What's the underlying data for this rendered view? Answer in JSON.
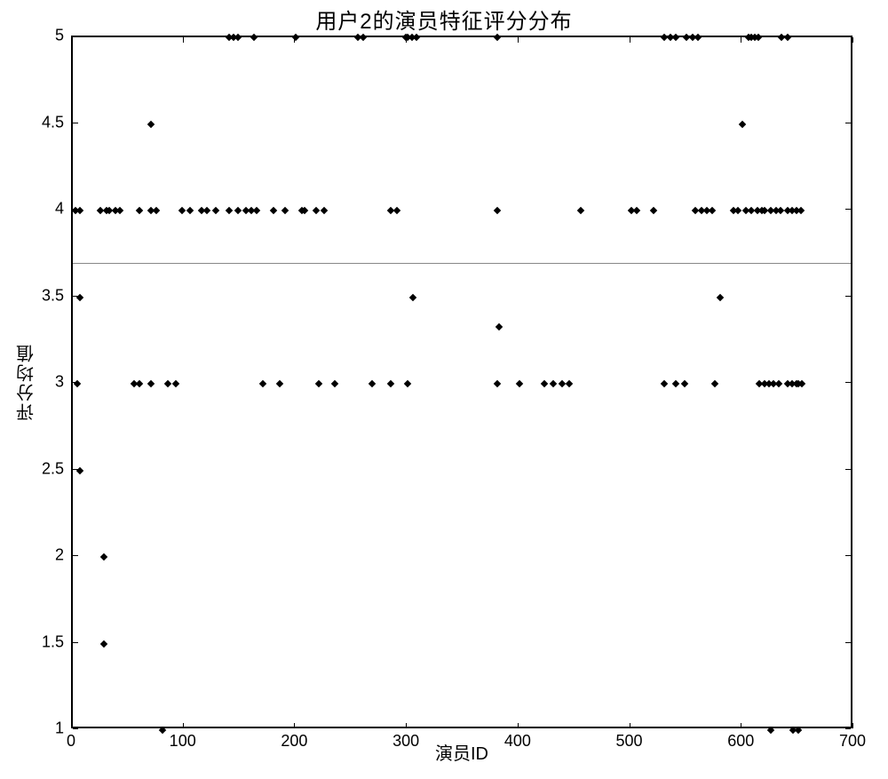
{
  "chart_data": {
    "type": "scatter",
    "title": "用户2的演员特征评分分布",
    "xlabel": "演员ID",
    "ylabel": "评分均值",
    "xlim": [
      0,
      700
    ],
    "ylim": [
      1,
      5
    ],
    "xticks": [
      0,
      100,
      200,
      300,
      400,
      500,
      600,
      700
    ],
    "yticks": [
      1,
      1.5,
      2,
      2.5,
      3,
      3.5,
      4,
      4.5,
      5
    ],
    "reference_line_y": 3.7,
    "points": [
      {
        "x": 2,
        "y": 4
      },
      {
        "x": 6,
        "y": 4
      },
      {
        "x": 4,
        "y": 3
      },
      {
        "x": 6,
        "y": 3.5
      },
      {
        "x": 6,
        "y": 2.5
      },
      {
        "x": 25,
        "y": 4
      },
      {
        "x": 30,
        "y": 4
      },
      {
        "x": 33,
        "y": 4
      },
      {
        "x": 38,
        "y": 4
      },
      {
        "x": 42,
        "y": 4
      },
      {
        "x": 28,
        "y": 2
      },
      {
        "x": 28,
        "y": 1.5
      },
      {
        "x": 55,
        "y": 3
      },
      {
        "x": 60,
        "y": 3
      },
      {
        "x": 60,
        "y": 4
      },
      {
        "x": 70,
        "y": 4
      },
      {
        "x": 70,
        "y": 3
      },
      {
        "x": 75,
        "y": 4
      },
      {
        "x": 85,
        "y": 3
      },
      {
        "x": 92,
        "y": 3
      },
      {
        "x": 98,
        "y": 4
      },
      {
        "x": 105,
        "y": 4
      },
      {
        "x": 70,
        "y": 4.5
      },
      {
        "x": 80,
        "y": 1
      },
      {
        "x": 115,
        "y": 4
      },
      {
        "x": 120,
        "y": 4
      },
      {
        "x": 128,
        "y": 4
      },
      {
        "x": 140,
        "y": 5
      },
      {
        "x": 144,
        "y": 5
      },
      {
        "x": 148,
        "y": 5
      },
      {
        "x": 140,
        "y": 4
      },
      {
        "x": 148,
        "y": 4
      },
      {
        "x": 155,
        "y": 4
      },
      {
        "x": 160,
        "y": 4
      },
      {
        "x": 165,
        "y": 4
      },
      {
        "x": 162,
        "y": 5
      },
      {
        "x": 170,
        "y": 3
      },
      {
        "x": 180,
        "y": 4
      },
      {
        "x": 185,
        "y": 3
      },
      {
        "x": 190,
        "y": 4
      },
      {
        "x": 200,
        "y": 5
      },
      {
        "x": 205,
        "y": 4
      },
      {
        "x": 208,
        "y": 4
      },
      {
        "x": 218,
        "y": 4
      },
      {
        "x": 225,
        "y": 4
      },
      {
        "x": 220,
        "y": 3
      },
      {
        "x": 235,
        "y": 3
      },
      {
        "x": 255,
        "y": 5
      },
      {
        "x": 260,
        "y": 5
      },
      {
        "x": 268,
        "y": 3
      },
      {
        "x": 285,
        "y": 4
      },
      {
        "x": 290,
        "y": 4
      },
      {
        "x": 285,
        "y": 3
      },
      {
        "x": 298,
        "y": 5
      },
      {
        "x": 300,
        "y": 5
      },
      {
        "x": 304,
        "y": 5
      },
      {
        "x": 308,
        "y": 5
      },
      {
        "x": 300,
        "y": 3
      },
      {
        "x": 305,
        "y": 3.5
      },
      {
        "x": 380,
        "y": 5
      },
      {
        "x": 380,
        "y": 4
      },
      {
        "x": 382,
        "y": 3.33
      },
      {
        "x": 380,
        "y": 3
      },
      {
        "x": 400,
        "y": 3
      },
      {
        "x": 422,
        "y": 3
      },
      {
        "x": 430,
        "y": 3
      },
      {
        "x": 438,
        "y": 3
      },
      {
        "x": 445,
        "y": 3
      },
      {
        "x": 455,
        "y": 4
      },
      {
        "x": 500,
        "y": 4
      },
      {
        "x": 505,
        "y": 4
      },
      {
        "x": 520,
        "y": 4
      },
      {
        "x": 530,
        "y": 3
      },
      {
        "x": 540,
        "y": 3
      },
      {
        "x": 548,
        "y": 3
      },
      {
        "x": 530,
        "y": 5
      },
      {
        "x": 535,
        "y": 5
      },
      {
        "x": 540,
        "y": 5
      },
      {
        "x": 550,
        "y": 5
      },
      {
        "x": 555,
        "y": 5
      },
      {
        "x": 560,
        "y": 5
      },
      {
        "x": 558,
        "y": 4
      },
      {
        "x": 563,
        "y": 4
      },
      {
        "x": 568,
        "y": 4
      },
      {
        "x": 573,
        "y": 4
      },
      {
        "x": 575,
        "y": 3
      },
      {
        "x": 580,
        "y": 3.5
      },
      {
        "x": 600,
        "y": 4.5
      },
      {
        "x": 605,
        "y": 5
      },
      {
        "x": 608,
        "y": 5
      },
      {
        "x": 611,
        "y": 5
      },
      {
        "x": 614,
        "y": 5
      },
      {
        "x": 635,
        "y": 5
      },
      {
        "x": 640,
        "y": 5
      },
      {
        "x": 592,
        "y": 4
      },
      {
        "x": 596,
        "y": 4
      },
      {
        "x": 603,
        "y": 4
      },
      {
        "x": 608,
        "y": 4
      },
      {
        "x": 613,
        "y": 4
      },
      {
        "x": 617,
        "y": 4
      },
      {
        "x": 620,
        "y": 4
      },
      {
        "x": 625,
        "y": 4
      },
      {
        "x": 630,
        "y": 4
      },
      {
        "x": 634,
        "y": 4
      },
      {
        "x": 640,
        "y": 4
      },
      {
        "x": 644,
        "y": 4
      },
      {
        "x": 648,
        "y": 4
      },
      {
        "x": 652,
        "y": 4
      },
      {
        "x": 615,
        "y": 3
      },
      {
        "x": 620,
        "y": 3
      },
      {
        "x": 624,
        "y": 3
      },
      {
        "x": 628,
        "y": 3
      },
      {
        "x": 632,
        "y": 3
      },
      {
        "x": 640,
        "y": 3
      },
      {
        "x": 644,
        "y": 3
      },
      {
        "x": 648,
        "y": 3
      },
      {
        "x": 650,
        "y": 3
      },
      {
        "x": 653,
        "y": 3
      },
      {
        "x": 625,
        "y": 1
      },
      {
        "x": 645,
        "y": 1
      },
      {
        "x": 650,
        "y": 1
      }
    ]
  }
}
